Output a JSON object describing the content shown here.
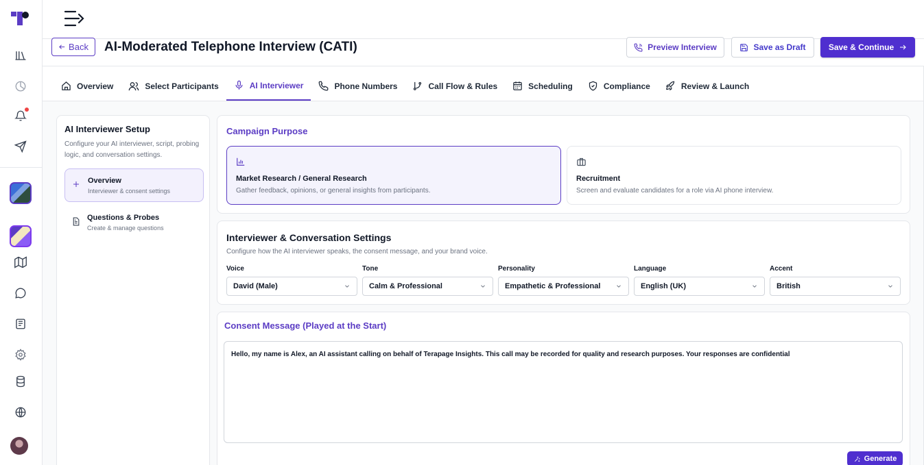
{
  "header": {
    "back_label": "Back",
    "title": "AI-Moderated Telephone Interview (CATI)",
    "preview_label": "Preview Interview",
    "draft_label": "Save as Draft",
    "continue_label": "Save & Continue"
  },
  "tabs": [
    {
      "label": "Overview",
      "icon": "home-icon"
    },
    {
      "label": "Select Participants",
      "icon": "users-icon"
    },
    {
      "label": "AI Interviewer",
      "icon": "microphone-icon",
      "active": true
    },
    {
      "label": "Phone Numbers",
      "icon": "phone-icon"
    },
    {
      "label": "Call Flow & Rules",
      "icon": "git-branch-icon"
    },
    {
      "label": "Scheduling",
      "icon": "calendar-icon"
    },
    {
      "label": "Compliance",
      "icon": "shield-check-icon"
    },
    {
      "label": "Review & Launch",
      "icon": "rocket-icon"
    }
  ],
  "setup": {
    "title": "AI Interviewer Setup",
    "description": "Configure your AI interviewer, script, probing logic, and conversation settings.",
    "items": [
      {
        "title": "Overview",
        "subtitle": "Interviewer & consent settings",
        "active": true
      },
      {
        "title": "Questions & Probes",
        "subtitle": "Create & manage questions",
        "active": false
      }
    ]
  },
  "purpose": {
    "title": "Campaign Purpose",
    "options": [
      {
        "title": "Market Research / General Research",
        "subtitle": "Gather feedback, opinions, or general insights from participants.",
        "selected": true,
        "icon": "bar-chart-icon"
      },
      {
        "title": "Recruitment",
        "subtitle": "Screen and evaluate candidates for a role via AI phone interview.",
        "selected": false,
        "icon": "briefcase-icon"
      }
    ]
  },
  "settings": {
    "title": "Interviewer & Conversation Settings",
    "description": "Configure how the AI interviewer speaks, the consent message, and your brand voice.",
    "fields": [
      {
        "label": "Voice",
        "value": "David (Male)"
      },
      {
        "label": "Tone",
        "value": "Calm & Professional"
      },
      {
        "label": "Personality",
        "value": "Empathetic & Professional"
      },
      {
        "label": "Language",
        "value": "English (UK)"
      },
      {
        "label": "Accent",
        "value": "British"
      }
    ]
  },
  "consent": {
    "title": "Consent Message (Played at the Start)",
    "message": "Hello, my name is Alex, an AI assistant calling on behalf of Terapage Insights. This call may be recorded for quality and research purposes. Your responses are confidential",
    "generate_label": "Generate"
  },
  "colors": {
    "accent": "#5b3cc4",
    "primary_button": "#4f2fcf",
    "notification": "#ef4444"
  }
}
